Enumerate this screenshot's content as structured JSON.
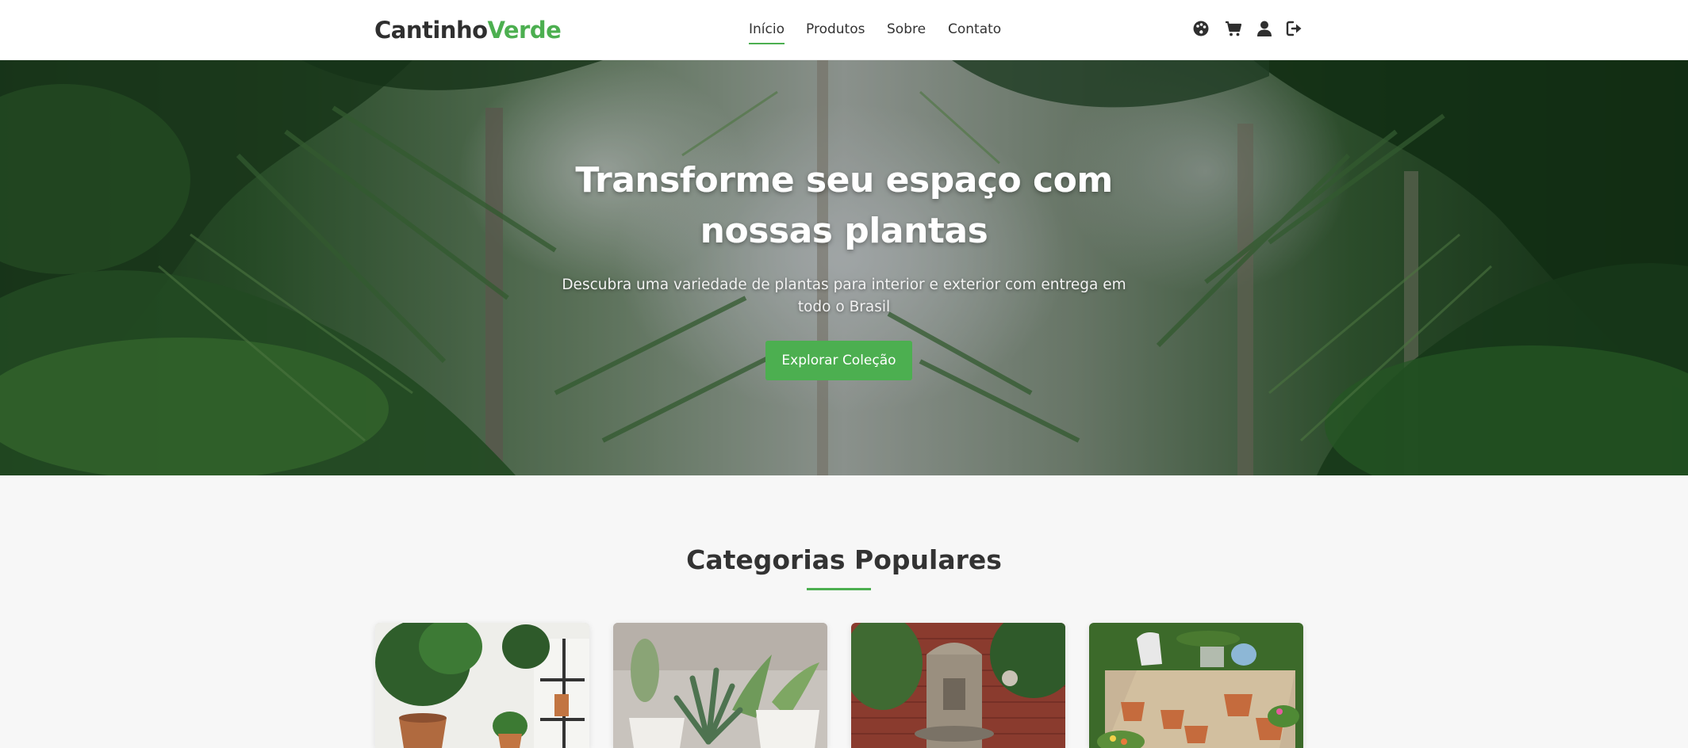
{
  "brand": {
    "part1": "Cantinho",
    "part2": "Verde",
    "accent_color": "#4caf50"
  },
  "nav": {
    "items": [
      {
        "label": "Início",
        "active": true
      },
      {
        "label": "Produtos",
        "active": false
      },
      {
        "label": "Sobre",
        "active": false
      },
      {
        "label": "Contato",
        "active": false
      }
    ]
  },
  "header_icons": [
    "palette-icon",
    "cart-icon",
    "user-icon",
    "logout-icon"
  ],
  "hero": {
    "title": "Transforme seu espaço com nossas plantas",
    "subtitle": "Descubra uma variedade de plantas para interior e exterior com entrega em todo o Brasil",
    "button_label": "Explorar Coleção"
  },
  "categories": {
    "title": "Categorias Populares",
    "cards": [
      {
        "image": "indoor-plants-shelf-image"
      },
      {
        "image": "succulents-pots-image"
      },
      {
        "image": "garden-fountain-image"
      },
      {
        "image": "gardening-tools-pots-image"
      }
    ]
  }
}
